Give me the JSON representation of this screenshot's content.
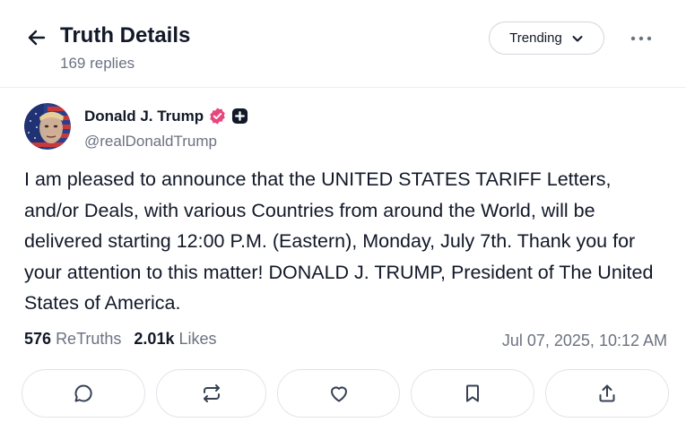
{
  "header": {
    "title": "Truth Details",
    "replies_count": "169 replies",
    "sort": {
      "selected": "Trending"
    }
  },
  "post": {
    "author": {
      "name": "Donald J. Trump",
      "handle": "@realDonaldTrump"
    },
    "text": "I am pleased to announce that the UNITED STATES TARIFF Letters, and/or Deals, with various Countries from around the World, will be delivered starting 12:00 P.M. (Eastern), Monday, July 7th. Thank you for your attention to this matter! DONALD J. TRUMP, President of The United States of America.",
    "stats": {
      "retruths_count": "576",
      "retruths_label": "ReTruths",
      "likes_count": "2.01k",
      "likes_label": "Likes"
    },
    "timestamp": "Jul 07, 2025, 10:12 AM"
  },
  "colors": {
    "verified_badge": "#e8467c",
    "text_primary": "#111827",
    "text_secondary": "#6b7280",
    "border": "#e2e4e8"
  },
  "icons": {
    "back": "arrow-left-icon",
    "sort": "chevron-down-icon",
    "more": "more-horizontal-icon",
    "verified": "verified-badge-icon",
    "plus": "plus-badge-icon",
    "reply": "comment-icon",
    "retruth": "repost-icon",
    "like": "heart-icon",
    "bookmark": "bookmark-icon",
    "share": "share-icon"
  }
}
